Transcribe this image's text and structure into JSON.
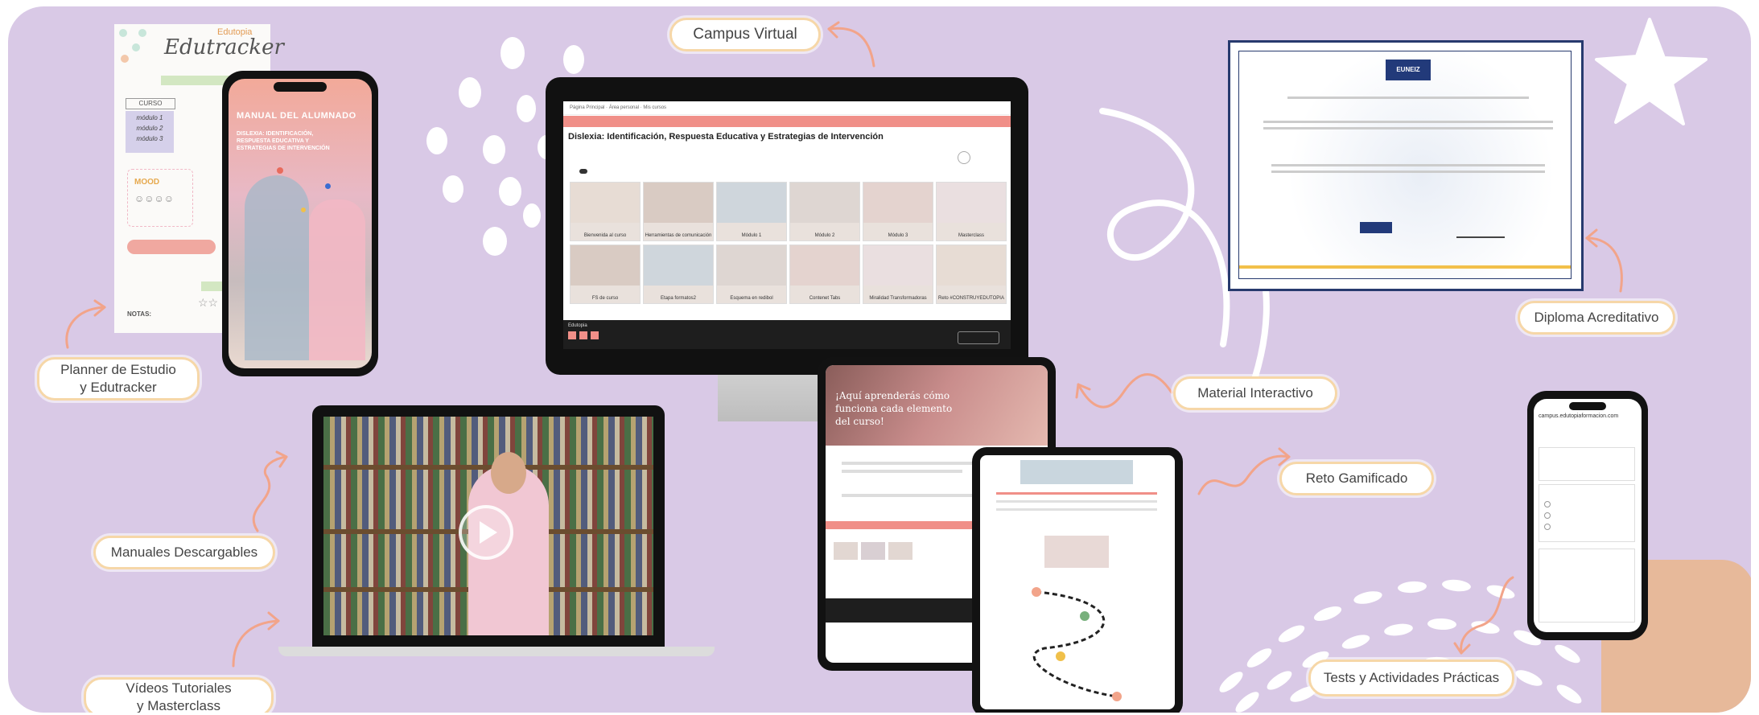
{
  "labels": {
    "campus_virtual": "Campus Virtual",
    "diploma": "Diploma Acreditativo",
    "planner_line1": "Planner de Estudio",
    "planner_line2": "y Edutracker",
    "material": "Material Interactivo",
    "reto": "Reto Gamificado",
    "manuales": "Manuales Descargables",
    "videos_line1": "Vídeos Tutoriales",
    "videos_line2": "y Masterclass",
    "tests": "Tests y Actividades Prácticas"
  },
  "planner": {
    "title": "Edutracker",
    "brand": "Edutopia",
    "curso_header": "CURSO",
    "modules": [
      "módulo 1",
      "módulo 2",
      "módulo 3"
    ],
    "notas_label": "NOTAS:"
  },
  "phone_manual": {
    "title": "MANUAL DEL ALUMNADO",
    "subtitle": "DISLEXIA: IDENTIFICACIÓN, RESPUESTA EDUCATIVA Y ESTRATEGIAS DE INTERVENCIÓN"
  },
  "monitor": {
    "course_title": "Dislexia: Identificación, Respuesta Educativa y Estrategias de Intervención",
    "thumbs": [
      "Bienvenida al curso",
      "Herramientas de comunicación",
      "Módulo 1",
      "Módulo 2",
      "Módulo 3",
      "Masterclass",
      "FS de curso",
      "Etapa formatos2",
      "Esquema en redibol",
      "Contenet Tabs",
      "Miralidad Transformadoras",
      "Reto #CONSTRUYEDUTOPIA"
    ],
    "footer_brand": "Edutopia"
  },
  "tablet": {
    "headline_1": "¡Aquí aprenderás cómo",
    "headline_2": "funciona cada elemento",
    "headline_3": "del curso!"
  },
  "mobile_test": {
    "url": "campus.edutopiaformacion.com"
  },
  "diploma": {
    "brand": "EUNEIZ"
  },
  "colors": {
    "background": "#d9c9e6",
    "pill_border": "#f6d7a8",
    "arrow": "#f2a48a",
    "course_header": "#f08f88"
  }
}
